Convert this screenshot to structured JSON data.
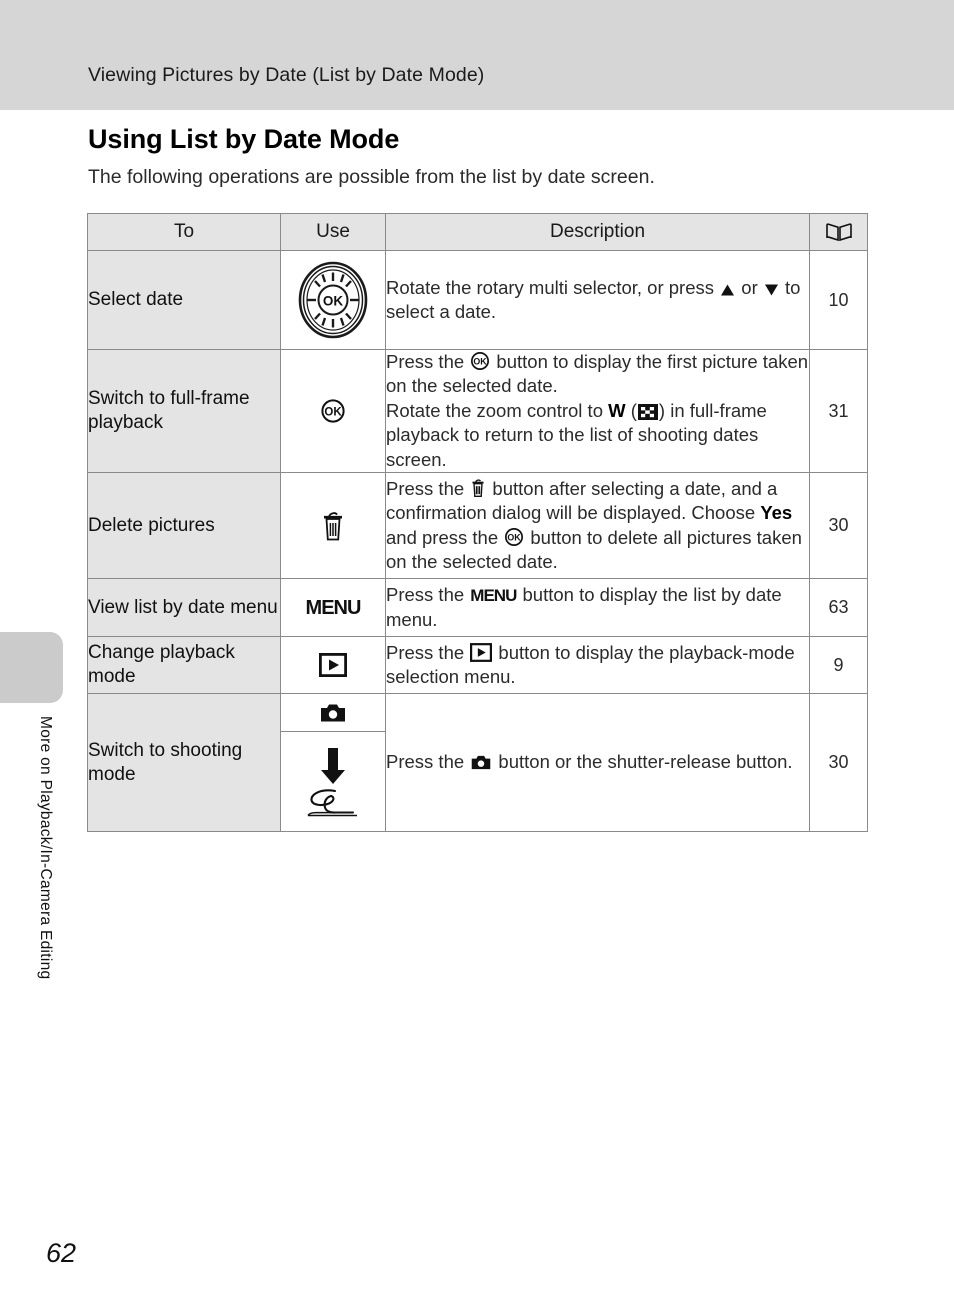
{
  "header": {
    "running_head": "Viewing Pictures by Date (List by Date Mode)"
  },
  "side": {
    "chapter_title": "More on Playback/In-Camera Editing"
  },
  "page": {
    "title": "Using List by Date Mode",
    "intro": "The following operations are possible from the list by date screen.",
    "number": "62"
  },
  "table": {
    "headers": {
      "to": "To",
      "use": "Use",
      "description": "Description",
      "reference_icon": "open-book-icon"
    },
    "rows": [
      {
        "to": "Select date",
        "use_icon": "rotary-multi-selector-icon",
        "description_parts": [
          {
            "type": "text",
            "value": "Rotate the rotary multi selector, or press "
          },
          {
            "type": "icon",
            "value": "up-triangle-icon"
          },
          {
            "type": "text",
            "value": " or "
          },
          {
            "type": "icon",
            "value": "down-triangle-icon"
          },
          {
            "type": "text",
            "value": " to select a date."
          }
        ],
        "description_plain": "Rotate the rotary multi selector, or press ▲ or ▼ to select a date.",
        "reference": "10"
      },
      {
        "to": "Switch to full-frame playback",
        "use_icon": "ok-button-icon",
        "description_plain": "Press the OK button to display the first picture taken on the selected date. Rotate the zoom control to W (thumbnail) in full-frame playback to return to the list of shooting dates screen.",
        "reference": "31"
      },
      {
        "to": "Delete pictures",
        "use_icon": "trash-can-icon",
        "description_plain": "Press the delete button after selecting a date, and a confirmation dialog will be displayed. Choose Yes and press the OK button to delete all pictures taken on the selected date.",
        "emphasis": "Yes",
        "reference": "30"
      },
      {
        "to": "View list by date menu",
        "use_icon": "menu-button-icon",
        "use_label": "MENU",
        "description_plain": "Press the MENU button to display the list by date menu.",
        "reference": "63"
      },
      {
        "to": "Change playback mode",
        "use_icon": "playback-button-icon",
        "description_plain": "Press the playback button to display the playback-mode selection menu.",
        "reference": "9"
      },
      {
        "to": "Switch to shooting mode",
        "use_icon_top": "camera-button-icon",
        "use_icon_arrow": "down-arrow-icon",
        "use_icon_bottom": "shutter-release-press-icon",
        "description_plain": "Press the camera button or the shutter-release button.",
        "reference": "30"
      }
    ]
  },
  "colors": {
    "header_band": "#d6d6d6",
    "side_tab": "#cbcbcb",
    "table_header_bg": "#e4e4e4",
    "table_border": "#8a8a8a",
    "text": "#2b2b2b"
  }
}
